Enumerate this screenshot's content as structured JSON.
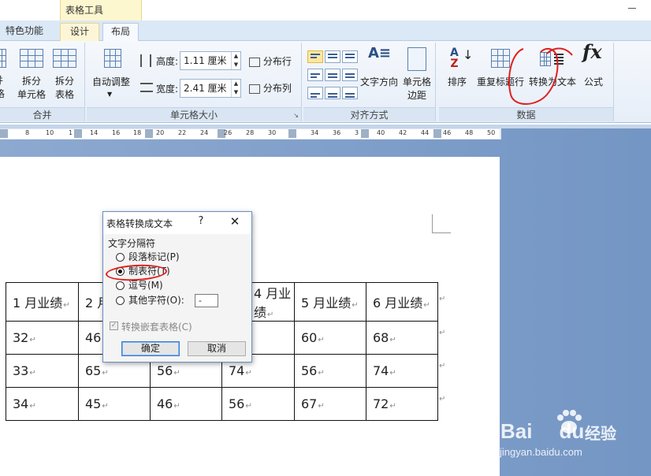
{
  "context_tab": {
    "label": "表格工具"
  },
  "tabs": [
    {
      "label": "特色功能"
    },
    {
      "label": "设计"
    },
    {
      "label": "布局"
    }
  ],
  "ribbon": {
    "merge_group": {
      "label": "合并",
      "split_cells_top": "拆分",
      "split_cells_bottom": "单元格",
      "split_table_top": "拆分",
      "split_table_bottom": "表格",
      "cut_top": "并",
      "cut_bottom": "元格"
    },
    "cell_size_group": {
      "label": "单元格大小",
      "autofit_label": "自动调整",
      "height_label": "高度:",
      "height_value": "1.11 厘米",
      "width_label": "宽度:",
      "width_value": "2.41 厘米",
      "distribute_rows": "分布行",
      "distribute_cols": "分布列"
    },
    "alignment_group": {
      "label": "对齐方式",
      "text_direction": "文字方向",
      "cell_margins_top": "单元格",
      "cell_margins_bottom": "边距"
    },
    "data_group": {
      "label": "数据",
      "sort": "排序",
      "repeat_header": "重复标题行",
      "convert_to_text": "转换为文本",
      "formula": "公式"
    }
  },
  "ruler": {
    "numbers": [
      "8",
      "10",
      "1",
      "14",
      "16",
      "18",
      "20",
      "22",
      "24",
      "26",
      "28",
      "30",
      "34",
      "36",
      "3",
      "40",
      "42",
      "44",
      "46",
      "48",
      "50"
    ]
  },
  "dialog": {
    "title": "表格转换成文本",
    "help": "?",
    "close": "✕",
    "group_label": "文字分隔符",
    "options": [
      {
        "label": "段落标记(P)",
        "selected": false
      },
      {
        "label": "制表符(T)",
        "selected": true
      },
      {
        "label": "逗号(M)",
        "selected": false
      },
      {
        "label": "其他字符(O):",
        "selected": false
      }
    ],
    "other_char_value": "-",
    "nested_tables_label": "转换嵌套表格(C)",
    "nested_tables_checked": true,
    "ok_label": "确定",
    "cancel_label": "取消"
  },
  "table": {
    "header": [
      "1 月业绩",
      "2 月业绩",
      "",
      "4 月业绩",
      "5 月业绩",
      "6 月业绩"
    ],
    "rows": [
      [
        "32",
        "46",
        "",
        "",
        "60",
        "68"
      ],
      [
        "33",
        "65",
        "56",
        "74",
        "56",
        "74"
      ],
      [
        "34",
        "45",
        "46",
        "56",
        "67",
        "72"
      ]
    ]
  },
  "watermark": {
    "brand": "Bai",
    "brand2": "du",
    "product": "经验",
    "url": "jingyan.baidu.com"
  },
  "colors": {
    "annotation": "#e02020",
    "accent": "#3b7bd1"
  }
}
